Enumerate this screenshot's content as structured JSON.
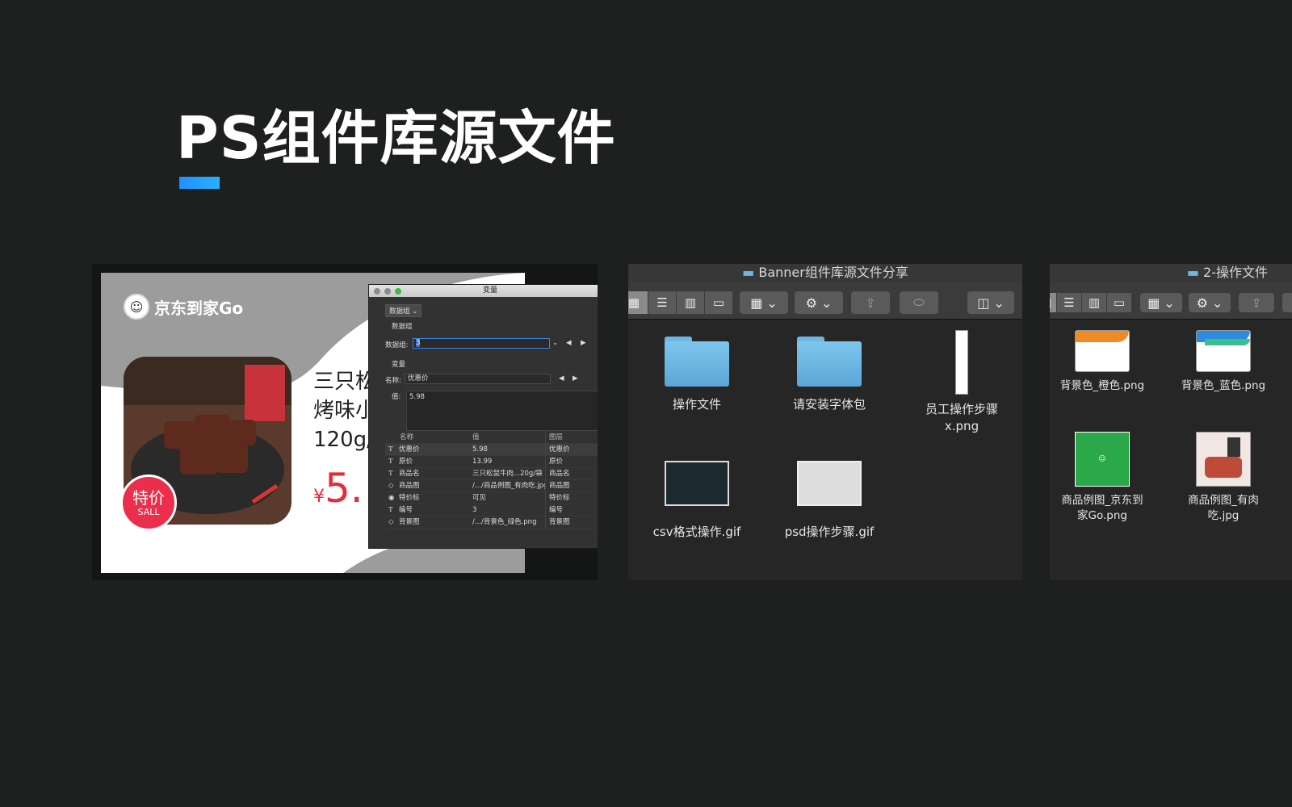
{
  "page": {
    "title": "PS组件库源文件"
  },
  "banner": {
    "brand": "京东到家Go",
    "product_name": "三只松\n烤味小\n120g/",
    "currency": "¥",
    "price": "5.",
    "badge_main": "特价",
    "badge_sub": "SALL"
  },
  "dialog": {
    "title": "变量",
    "dataset_select": "数据组",
    "dataset_section": "数据组",
    "dataset_label": "数据组:",
    "dataset_value": "3",
    "variable_section": "变量",
    "name_label": "名称:",
    "name_value": "优惠价",
    "value_label": "值:",
    "value_text": "5.98",
    "headers": [
      "名称",
      "值",
      "图层"
    ],
    "rows": [
      {
        "icon": "T",
        "name": "优惠价",
        "value": "5.98",
        "layer": "优惠价"
      },
      {
        "icon": "T",
        "name": "原价",
        "value": "13.99",
        "layer": "原价"
      },
      {
        "icon": "T",
        "name": "商品名",
        "value": "三只松鼠牛肉...20g/袋",
        "layer": "商品名"
      },
      {
        "icon": "◇",
        "name": "商品图",
        "value": "/.../商品例图_有肉吃.jpg",
        "layer": "商品图"
      },
      {
        "icon": "◉",
        "name": "特价标",
        "value": "可见",
        "layer": "特价标"
      },
      {
        "icon": "T",
        "name": "编号",
        "value": "3",
        "layer": "编号"
      },
      {
        "icon": "◇",
        "name": "背景图",
        "value": "/.../背景色_绿色.png",
        "layer": "背景图"
      }
    ]
  },
  "finder1": {
    "title": "Banner组件库源文件分享",
    "items": [
      {
        "label": "操作文件",
        "type": "folder"
      },
      {
        "label": "请安装字体包",
        "type": "folder"
      },
      {
        "label": "员工操作步骤x.png",
        "type": "image-tall"
      },
      {
        "label": "csv格式操作.gif",
        "type": "image"
      },
      {
        "label": "psd操作步骤.gif",
        "type": "image"
      }
    ]
  },
  "finder2": {
    "title": "2-操作文件",
    "items": [
      {
        "label": "背景色_橙色.png",
        "accent": "#f08a24"
      },
      {
        "label": "背景色_蓝色.png",
        "accent": "#2d8be0"
      },
      {
        "label": "商品例图_京东到家Go.png",
        "accent": "#2aa84a"
      },
      {
        "label": "商品例图_有肉吃.jpg",
        "accent": "#c04a3a"
      }
    ]
  },
  "colors": {
    "accent_blue": "#1e90ff",
    "sale_red": "#ea2e4b",
    "price_red": "#e52c3b"
  }
}
